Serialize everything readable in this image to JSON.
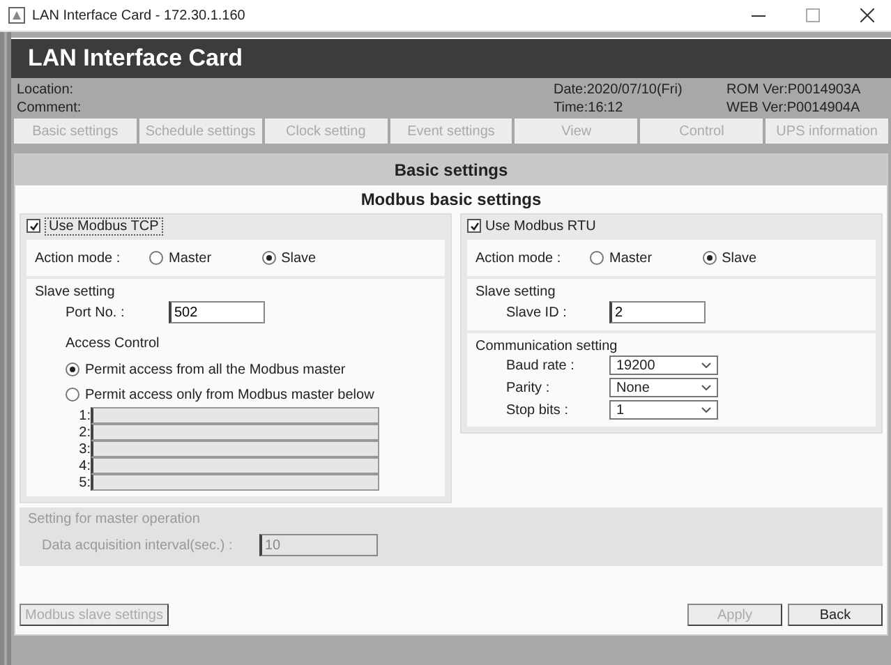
{
  "window": {
    "title": "LAN Interface Card - 172.30.1.160"
  },
  "header": {
    "title": "LAN Interface Card"
  },
  "info": {
    "location": "Location:",
    "comment": "Comment:",
    "date": "Date:2020/07/10(Fri)",
    "time": "Time:16:12",
    "rom": "ROM Ver:P0014903A",
    "web": "WEB Ver:P0014904A"
  },
  "tabs": [
    {
      "label": "Basic settings",
      "disabled": true
    },
    {
      "label": "Schedule settings",
      "disabled": true
    },
    {
      "label": "Clock setting",
      "disabled": true
    },
    {
      "label": "Event settings",
      "disabled": true
    },
    {
      "label": "View",
      "disabled": true
    },
    {
      "label": "Control",
      "disabled": true
    },
    {
      "label": "UPS information",
      "disabled": true
    }
  ],
  "page_title": "Basic settings",
  "section_title": "Modbus basic settings",
  "tcp": {
    "label": "Use Modbus TCP",
    "checked": true,
    "action_label": "Action mode :",
    "modes": [
      {
        "label": "Master",
        "selected": false
      },
      {
        "label": "Slave",
        "selected": true
      }
    ],
    "slave_title": "Slave setting",
    "port_label": "Port No. :",
    "port_value": "502",
    "access_title": "Access Control",
    "access_options": [
      {
        "label": "Permit access from all the Modbus master",
        "selected": true
      },
      {
        "label": "Permit access only from Modbus master below",
        "selected": false
      }
    ],
    "masters": [
      {
        "label": "1:",
        "disabled": true
      },
      {
        "label": "2:",
        "disabled": true
      },
      {
        "label": "3:",
        "disabled": true
      },
      {
        "label": "4:",
        "disabled": true
      },
      {
        "label": "5:",
        "disabled": true
      }
    ]
  },
  "rtu": {
    "label": "Use Modbus RTU",
    "checked": true,
    "action_label": "Action mode :",
    "modes": [
      {
        "label": "Master",
        "selected": false
      },
      {
        "label": "Slave",
        "selected": true
      }
    ],
    "slave_title": "Slave setting",
    "id_label": "Slave ID :",
    "id_value": "2",
    "comm_title": "Communication setting",
    "selects": [
      {
        "label": "Baud rate :",
        "value": "19200"
      },
      {
        "label": "Parity :",
        "value": "None"
      },
      {
        "label": "Stop bits :",
        "value": "1"
      }
    ]
  },
  "master_op": {
    "title": "Setting for master operation",
    "interval_label": "Data acquisition interval(sec.) :",
    "interval_value": "10",
    "disabled": true
  },
  "buttons": [
    {
      "label": "Modbus slave settings",
      "disabled": true
    },
    {
      "label": "Apply",
      "disabled": true
    },
    {
      "label": "Back",
      "disabled": false
    }
  ]
}
